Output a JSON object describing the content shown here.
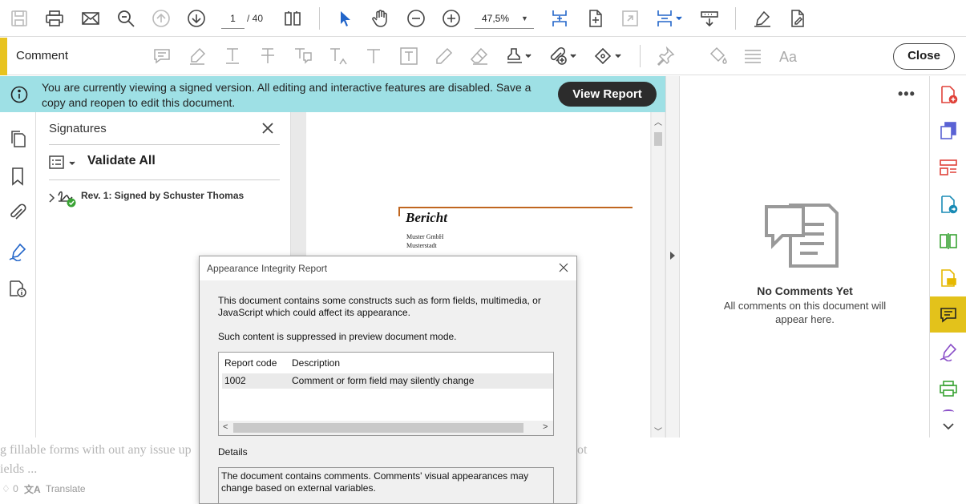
{
  "toolbar": {
    "page_current": "1",
    "page_sep": "/ 40",
    "zoom": "47,5%",
    "icons": [
      "save-icon",
      "print-icon",
      "email-icon",
      "zoom-search-icon",
      "page-up-icon",
      "page-down-icon",
      "page-view-icon",
      "select-arrow-icon",
      "hand-icon",
      "zoom-out-icon",
      "zoom-in-icon",
      "fit-page-icon",
      "rotate-icon",
      "fullscreen-icon",
      "page-layout-icon",
      "scroll-mode-icon",
      "sign-icon",
      "edit-pdf-icon"
    ]
  },
  "commentbar": {
    "title": "Comment",
    "close_label": "Close",
    "accent_color": "#e8c31f"
  },
  "banner": {
    "message": "You are currently viewing a signed version. All editing and interactive features are disabled. Save a copy and reopen to edit this document.",
    "button_label": "View Report",
    "color": "#9ee0e5"
  },
  "signatures": {
    "title": "Signatures",
    "validate_label": "Validate All",
    "revision_label": "Rev. 1: Signed by Schuster Thomas"
  },
  "document": {
    "heading": "Bericht",
    "line1": "Muster GmbH",
    "line2": "Musterstadt"
  },
  "comments": {
    "empty_title": "No Comments Yet",
    "empty_sub": "All comments on this document will appear here.",
    "more_label": "•••"
  },
  "background_page": {
    "line1": "g fillable forms with out any issue up",
    "line1_tail": "ot",
    "line2": "ields ...",
    "like_count": "0",
    "translate_label": "Translate"
  },
  "dialog": {
    "title": "Appearance Integrity Report",
    "para1": "This document contains some constructs such as form fields, multimedia, or JavaScript which could affect its appearance.",
    "para2": "Such content is suppressed in preview document mode.",
    "table": {
      "headers": [
        "Report code",
        "Description"
      ],
      "rows": [
        {
          "code": "1002",
          "description": "Comment or form field may silently change"
        }
      ]
    },
    "details_label": "Details",
    "details_text": "The document contains comments. Comments' visual appearances may change based on external variables."
  }
}
